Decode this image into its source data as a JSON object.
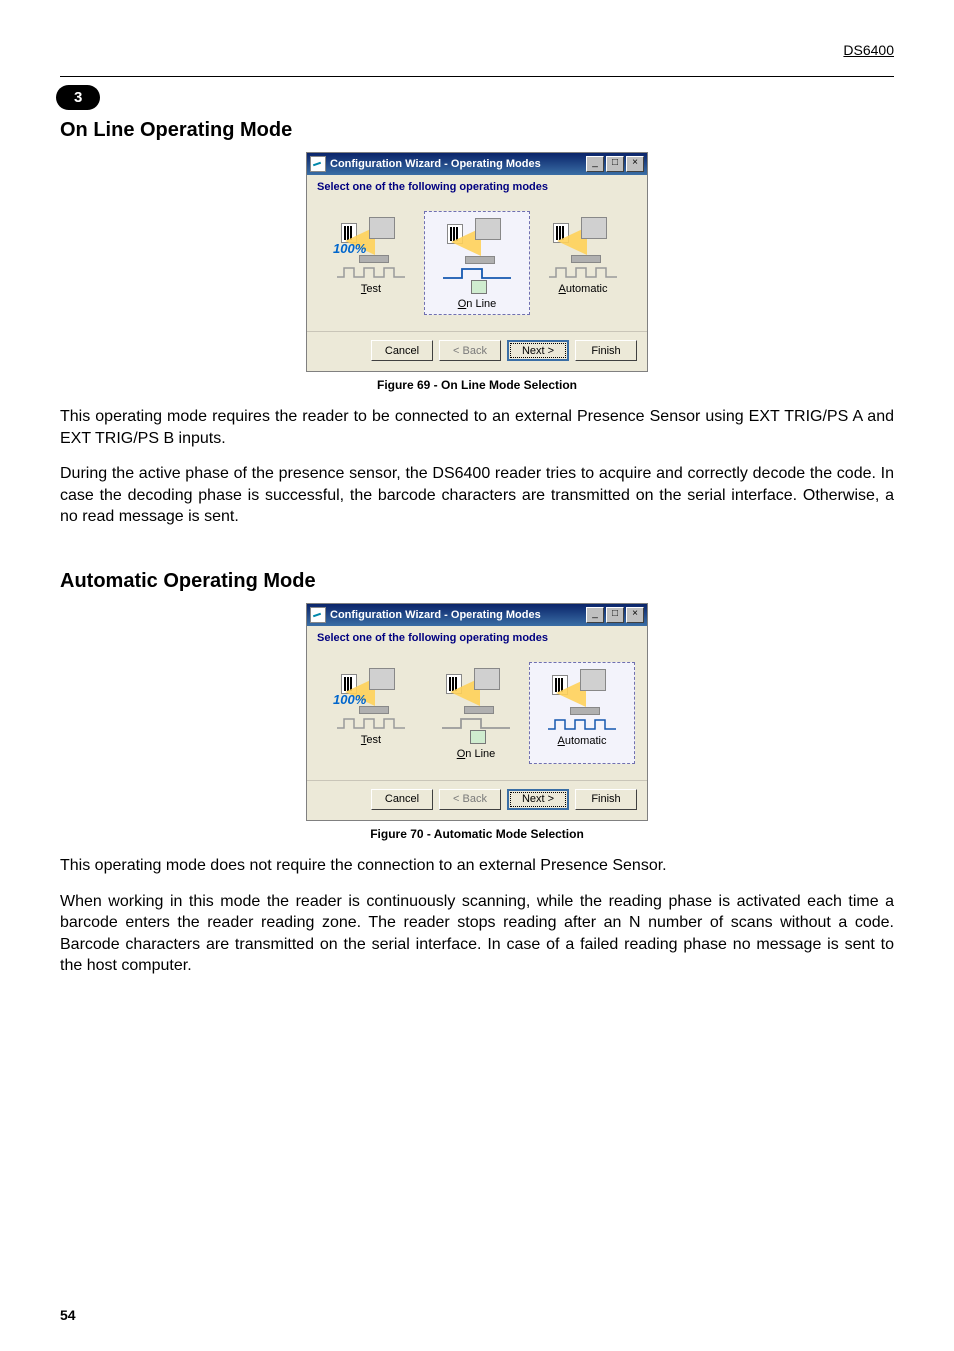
{
  "header": {
    "model": "DS6400",
    "chapter": "3"
  },
  "section1": {
    "title": "On Line Operating Mode",
    "fig_caption": "Figure 69 - On Line Mode Selection",
    "para1": "This operating mode requires the reader to be connected to an external Presence Sensor using EXT TRIG/PS A and EXT TRIG/PS B inputs.",
    "para2": "During the active phase of the presence sensor, the DS6400 reader tries to acquire and correctly decode the code. In case the decoding phase is successful, the barcode characters are transmitted on the serial interface. Otherwise, a no read message is sent."
  },
  "section2": {
    "title": "Automatic Operating Mode",
    "fig_caption": "Figure 70 - Automatic Mode Selection",
    "para1": "This operating mode does not require the connection to an external Presence Sensor.",
    "para2": "When working in this mode the reader is continuously scanning, while the reading phase is activated each time a barcode enters the reader reading zone. The reader stops reading after an N number of scans without a code. Barcode characters are transmitted on the serial interface. In case of a failed reading phase no message is sent to the host computer."
  },
  "wizard": {
    "title": "Configuration Wizard - Operating Modes",
    "subtitle": "Select one of the following operating modes",
    "pct": "100%",
    "modes": {
      "test": {
        "label_pre": "T",
        "label_rest": "est"
      },
      "online": {
        "label_pre": "O",
        "label_rest": "n Line"
      },
      "auto": {
        "label_pre": "A",
        "label_rest": "utomatic"
      }
    },
    "buttons": {
      "cancel": "Cancel",
      "back_pre": "< ",
      "back_ul": "B",
      "back_rest": "ack",
      "next_pre": "N",
      "next_rest": "ext >",
      "finish_pre": "F",
      "finish_rest": "inish"
    },
    "winctrls": {
      "min": "_",
      "max": "□",
      "close": "×"
    }
  },
  "page_number": "54"
}
